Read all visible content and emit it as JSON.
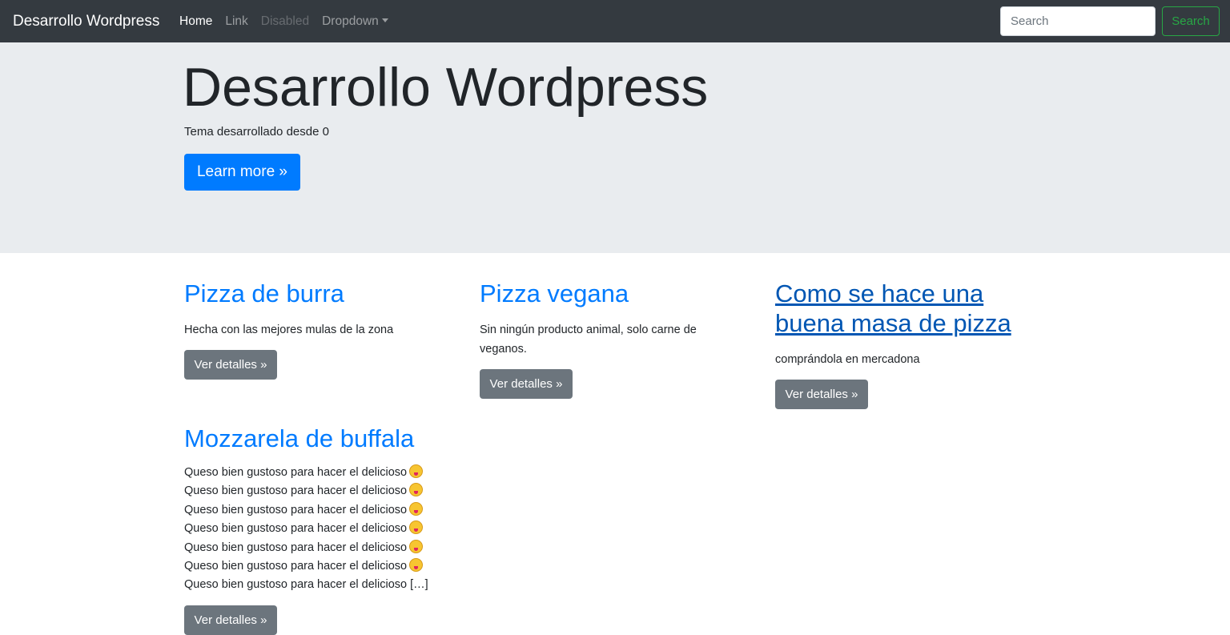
{
  "navbar": {
    "brand": "Desarrollo Wordpress",
    "links": [
      {
        "label": "Home",
        "state": "active"
      },
      {
        "label": "Link",
        "state": "normal"
      },
      {
        "label": "Disabled",
        "state": "disabled"
      },
      {
        "label": "Dropdown",
        "state": "dropdown"
      }
    ],
    "search_placeholder": "Search",
    "search_button": "Search"
  },
  "jumbotron": {
    "title": "Desarrollo Wordpress",
    "subtitle": "Tema desarrollado desde 0",
    "button": "Learn more »"
  },
  "posts": [
    {
      "title": "Pizza de burra",
      "excerpt": "Hecha con las mejores mulas de la zona",
      "button": "Ver detalles »"
    },
    {
      "title": "Pizza vegana",
      "excerpt_line1": "Sin ningún producto animal, solo carne de",
      "excerpt_line2": "veganos.",
      "button": "Ver detalles »"
    },
    {
      "title_line1": "Como se hace una",
      "title_line2": "buena masa de pizza",
      "excerpt": "comprándola en mercadona",
      "button": "Ver detalles »"
    },
    {
      "title": "Mozzarela de buffala",
      "line": "Queso bien gustoso para hacer el delicioso",
      "last_line": "Queso bien gustoso para hacer el delicioso […]",
      "button": "Ver detalles »"
    }
  ],
  "colors": {
    "navbar_bg": "#343a40",
    "jumbotron_bg": "#e9ecef",
    "link_blue": "#007bff",
    "primary_button": "#007bff",
    "secondary_button": "#6c757d",
    "search_outline": "#28a745"
  }
}
